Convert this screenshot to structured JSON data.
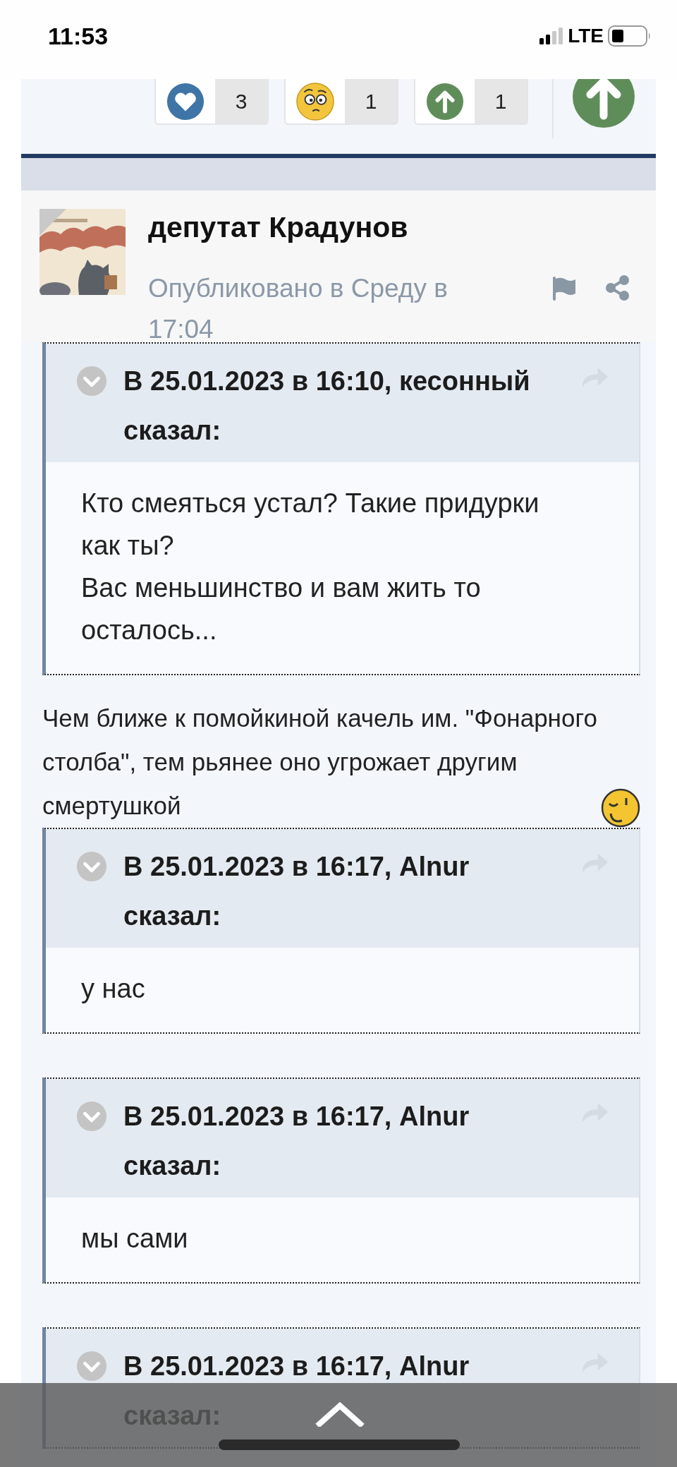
{
  "status_bar": {
    "time": "11:53",
    "network": "LTE"
  },
  "reactions": [
    {
      "kind": "heart",
      "count": "3"
    },
    {
      "kind": "confused",
      "count": "1"
    },
    {
      "kind": "upvote",
      "count": "1"
    }
  ],
  "post": {
    "author": "депутат Крадунов",
    "published": "Опубликовано в Среду в 17:04",
    "content": [
      {
        "kind": "quote",
        "header": "В 25.01.2023 в 16:10, кесонный сказал:",
        "lines": [
          "Кто смеяться устал? Такие придурки как ты?",
          "Вас меньшинство и вам жить то осталось..."
        ]
      },
      {
        "kind": "text",
        "text": "Чем ближе к помойкиной качель им. \"Фонарного столба\", тем рьянее оно угрожает другим смертушкой"
      },
      {
        "kind": "quote",
        "header": "В 25.01.2023 в 16:17, Alnur сказал:",
        "lines": [
          "у нас"
        ]
      },
      {
        "kind": "quote",
        "header": "В 25.01.2023 в 16:17, Alnur сказал:",
        "lines": [
          "мы сами"
        ]
      },
      {
        "kind": "quote",
        "header": "В 25.01.2023 в 16:17, Alnur сказал:"
      }
    ]
  }
}
